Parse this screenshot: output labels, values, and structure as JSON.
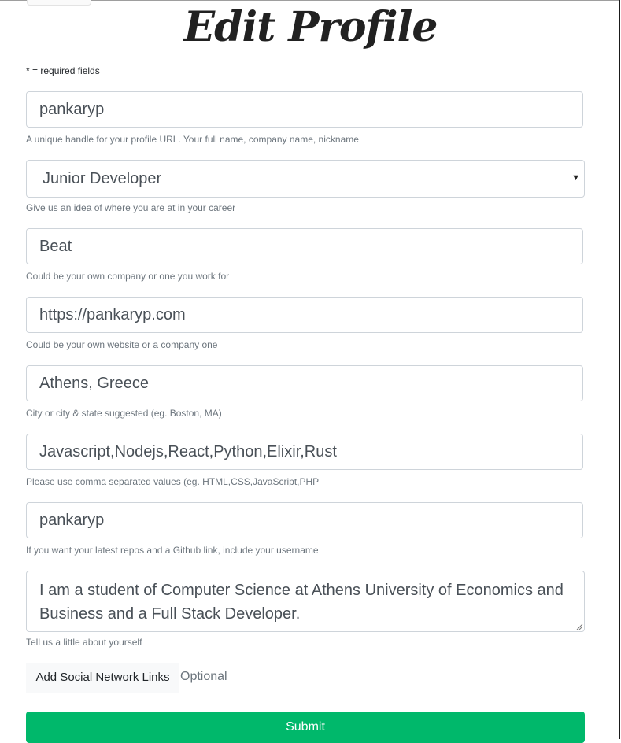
{
  "page": {
    "title": "Edit Profile",
    "required_note": "* = required fields"
  },
  "form": {
    "handle": {
      "value": "pankaryp",
      "help": "A unique handle for your profile URL. Your full name, company name, nickname"
    },
    "status": {
      "selected": "Junior Developer",
      "help": "Give us an idea of where you are at in your career"
    },
    "company": {
      "value": "Beat",
      "help": "Could be your own company or one you work for"
    },
    "website": {
      "value": "https://pankaryp.com",
      "help": "Could be your own website or a company one"
    },
    "location": {
      "value": "Athens, Greece",
      "help": "City or city & state suggested (eg. Boston, MA)"
    },
    "skills": {
      "value": "Javascript,Nodejs,React,Python,Elixir,Rust",
      "help": "Please use comma separated values (eg. HTML,CSS,JavaScript,PHP"
    },
    "github": {
      "value": "pankaryp",
      "help": "If you want your latest repos and a Github link, include your username"
    },
    "bio": {
      "value": "I am a student of Computer Science at Athens University of Economics and Business and a Full Stack Developer.",
      "help": "Tell us a little about yourself"
    }
  },
  "social": {
    "button_label": "Add Social Network Links",
    "optional_label": "Optional"
  },
  "submit_label": "Submit",
  "icons": {
    "select_caret": "caret-down-icon",
    "resize": "resize-grip-icon"
  },
  "colors": {
    "submit": "#00b86b",
    "border": "#ced4da",
    "help_text": "#6c757d"
  }
}
